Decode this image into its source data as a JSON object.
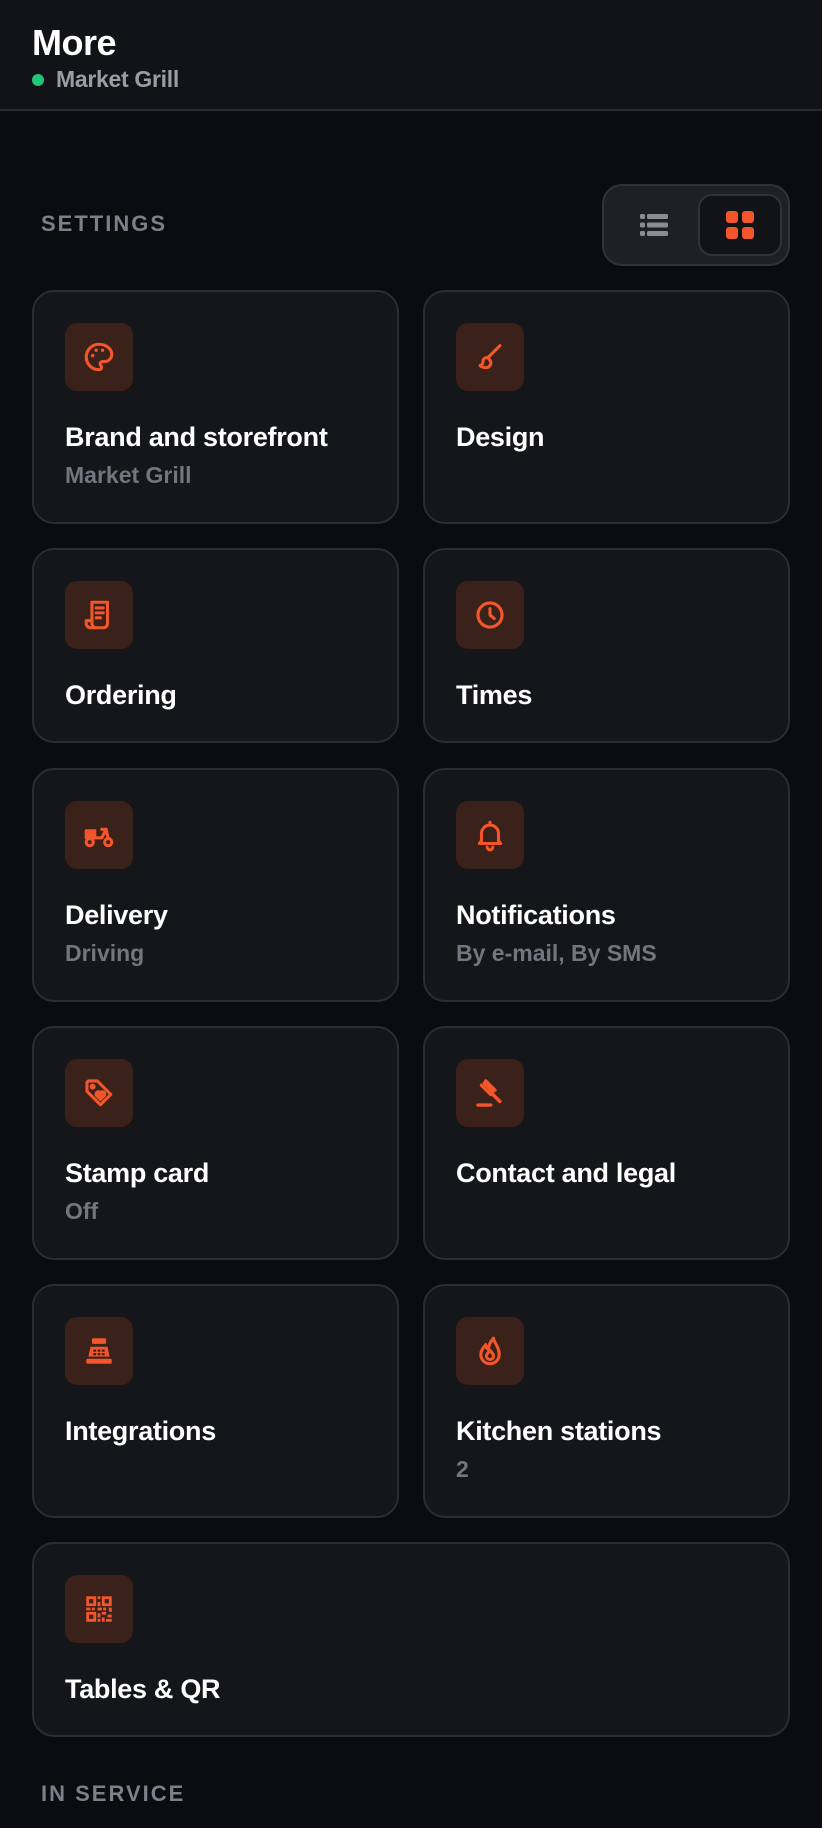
{
  "header": {
    "title": "More",
    "subtitle": "Market Grill"
  },
  "colors": {
    "accent": "#f2562a",
    "status_online": "#22c47c",
    "card_bg": "#15161a",
    "icon_bg": "#3a211a"
  },
  "settings": {
    "section_label": "SETTINGS",
    "view_toggle": {
      "options": [
        "list",
        "grid"
      ],
      "selected": "grid"
    },
    "cards": [
      {
        "title": "Brand and storefront",
        "subtitle": "Market Grill",
        "icon": "palette-icon"
      },
      {
        "title": "Design",
        "subtitle": "",
        "icon": "paintbrush-icon"
      },
      {
        "title": "Ordering",
        "subtitle": "",
        "icon": "receipt-icon"
      },
      {
        "title": "Times",
        "subtitle": "",
        "icon": "clock-icon"
      },
      {
        "title": "Delivery",
        "subtitle": "Driving",
        "icon": "scooter-icon"
      },
      {
        "title": "Notifications",
        "subtitle": "By e-mail, By SMS",
        "icon": "bell-icon"
      },
      {
        "title": "Stamp card",
        "subtitle": "Off",
        "icon": "tag-heart-icon"
      },
      {
        "title": "Contact and legal",
        "subtitle": "",
        "icon": "gavel-icon"
      },
      {
        "title": "Integrations",
        "subtitle": "",
        "icon": "cash-register-icon"
      },
      {
        "title": "Kitchen stations",
        "subtitle": "2",
        "icon": "fire-icon"
      },
      {
        "title": "Tables & QR",
        "subtitle": "",
        "icon": "qr-code-icon"
      }
    ]
  },
  "in_service": {
    "section_label": "IN SERVICE"
  }
}
